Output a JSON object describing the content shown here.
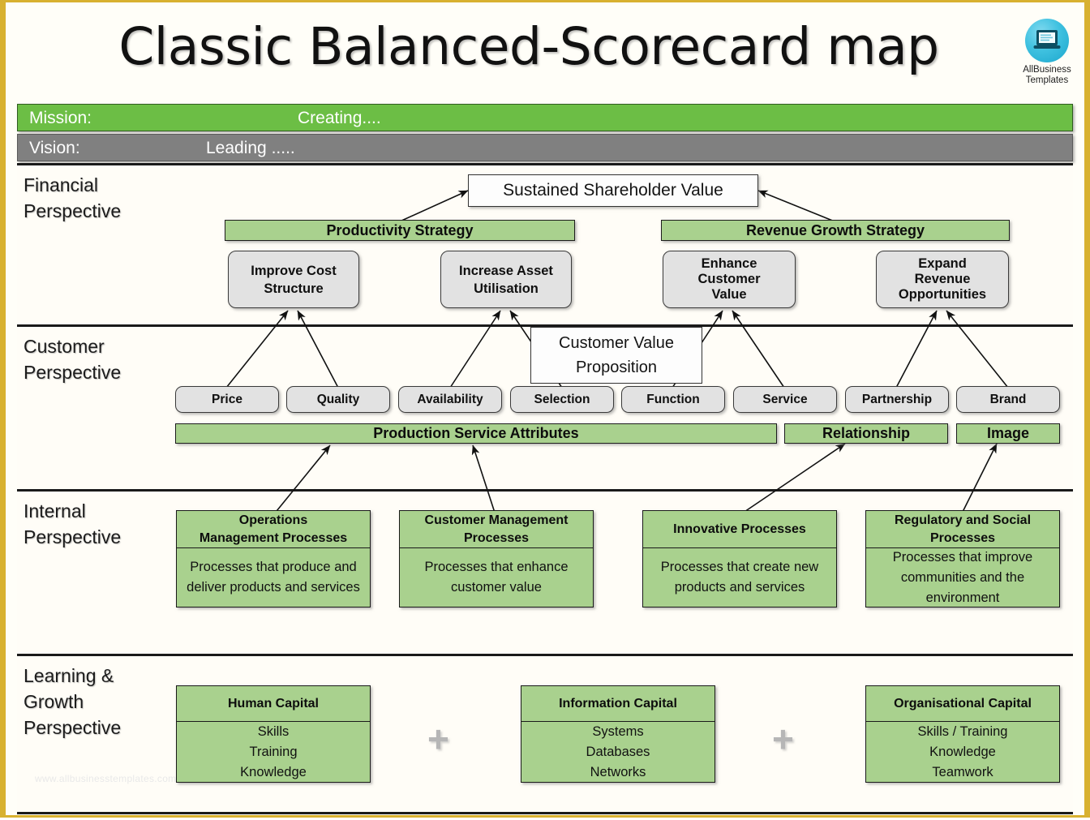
{
  "title": "Classic Balanced-Scorecard map",
  "logo": {
    "line1": "AllBusiness",
    "line2": "Templates",
    "icon": "laptop-icon",
    "color": "#2fb8db"
  },
  "watermark": "www.allbusinesstemplates.com",
  "ribbons": {
    "mission": {
      "label": "Mission:",
      "value": "Creating....",
      "color": "#6cbe45"
    },
    "vision": {
      "label": "Vision:",
      "value": "Leading .....",
      "color": "#808080"
    }
  },
  "perspectives": {
    "financial": "Financial\nPerspective",
    "financial_l1": "Financial",
    "financial_l2": "Perspective",
    "customer_l1": "Customer",
    "customer_l2": "Perspective",
    "internal_l1": "Internal",
    "internal_l2": "Perspective",
    "learning_l1": "Learning &",
    "learning_l2": "Growth",
    "learning_l3": "Perspective"
  },
  "financial": {
    "apex": "Sustained Shareholder Value",
    "strategies": [
      {
        "name": "Productivity Strategy"
      },
      {
        "name": "Revenue Growth Strategy"
      }
    ],
    "objectives": [
      {
        "line1": "Improve Cost",
        "line2": "Structure"
      },
      {
        "line1": "Increase Asset",
        "line2": "Utilisation"
      },
      {
        "line1": "Enhance",
        "line2": "Customer",
        "line3": "Value"
      },
      {
        "line1": "Expand",
        "line2": "Revenue",
        "line3": "Opportunities"
      }
    ]
  },
  "customer": {
    "proposition_l1": "Customer Value",
    "proposition_l2": "Proposition",
    "attributes": [
      "Price",
      "Quality",
      "Availability",
      "Selection",
      "Function",
      "Service",
      "Partnership",
      "Brand"
    ],
    "groups": [
      "Production Service Attributes",
      "Relationship",
      "Image"
    ]
  },
  "internal": {
    "processes": [
      {
        "title_l1": "Operations",
        "title_l2": "Management Processes",
        "desc": "Processes that produce and deliver products and services"
      },
      {
        "title_l1": "Customer Management",
        "title_l2": "Processes",
        "desc": "Processes that enhance customer value"
      },
      {
        "title_l1": "Innovative Processes",
        "title_l2": "",
        "desc": "Processes that create new products and services"
      },
      {
        "title_l1": "Regulatory and Social",
        "title_l2": "Processes",
        "desc": "Processes that improve communities and the environment"
      }
    ]
  },
  "learning": {
    "plus": "+",
    "capitals": [
      {
        "title": "Human Capital",
        "items": "Skills\nTraining\nKnowledge"
      },
      {
        "title": "Information Capital",
        "items": "Systems\nDatabases\nNetworks"
      },
      {
        "title": "Organisational Capital",
        "items": "Skills / Training\nKnowledge\nTeamwork"
      }
    ]
  },
  "colors": {
    "green_bar": "#a9d18e",
    "mission_green": "#6cbe45",
    "vision_gray": "#808080",
    "gray_box": "#e2e2e2",
    "border_gold": "#d8b130"
  }
}
